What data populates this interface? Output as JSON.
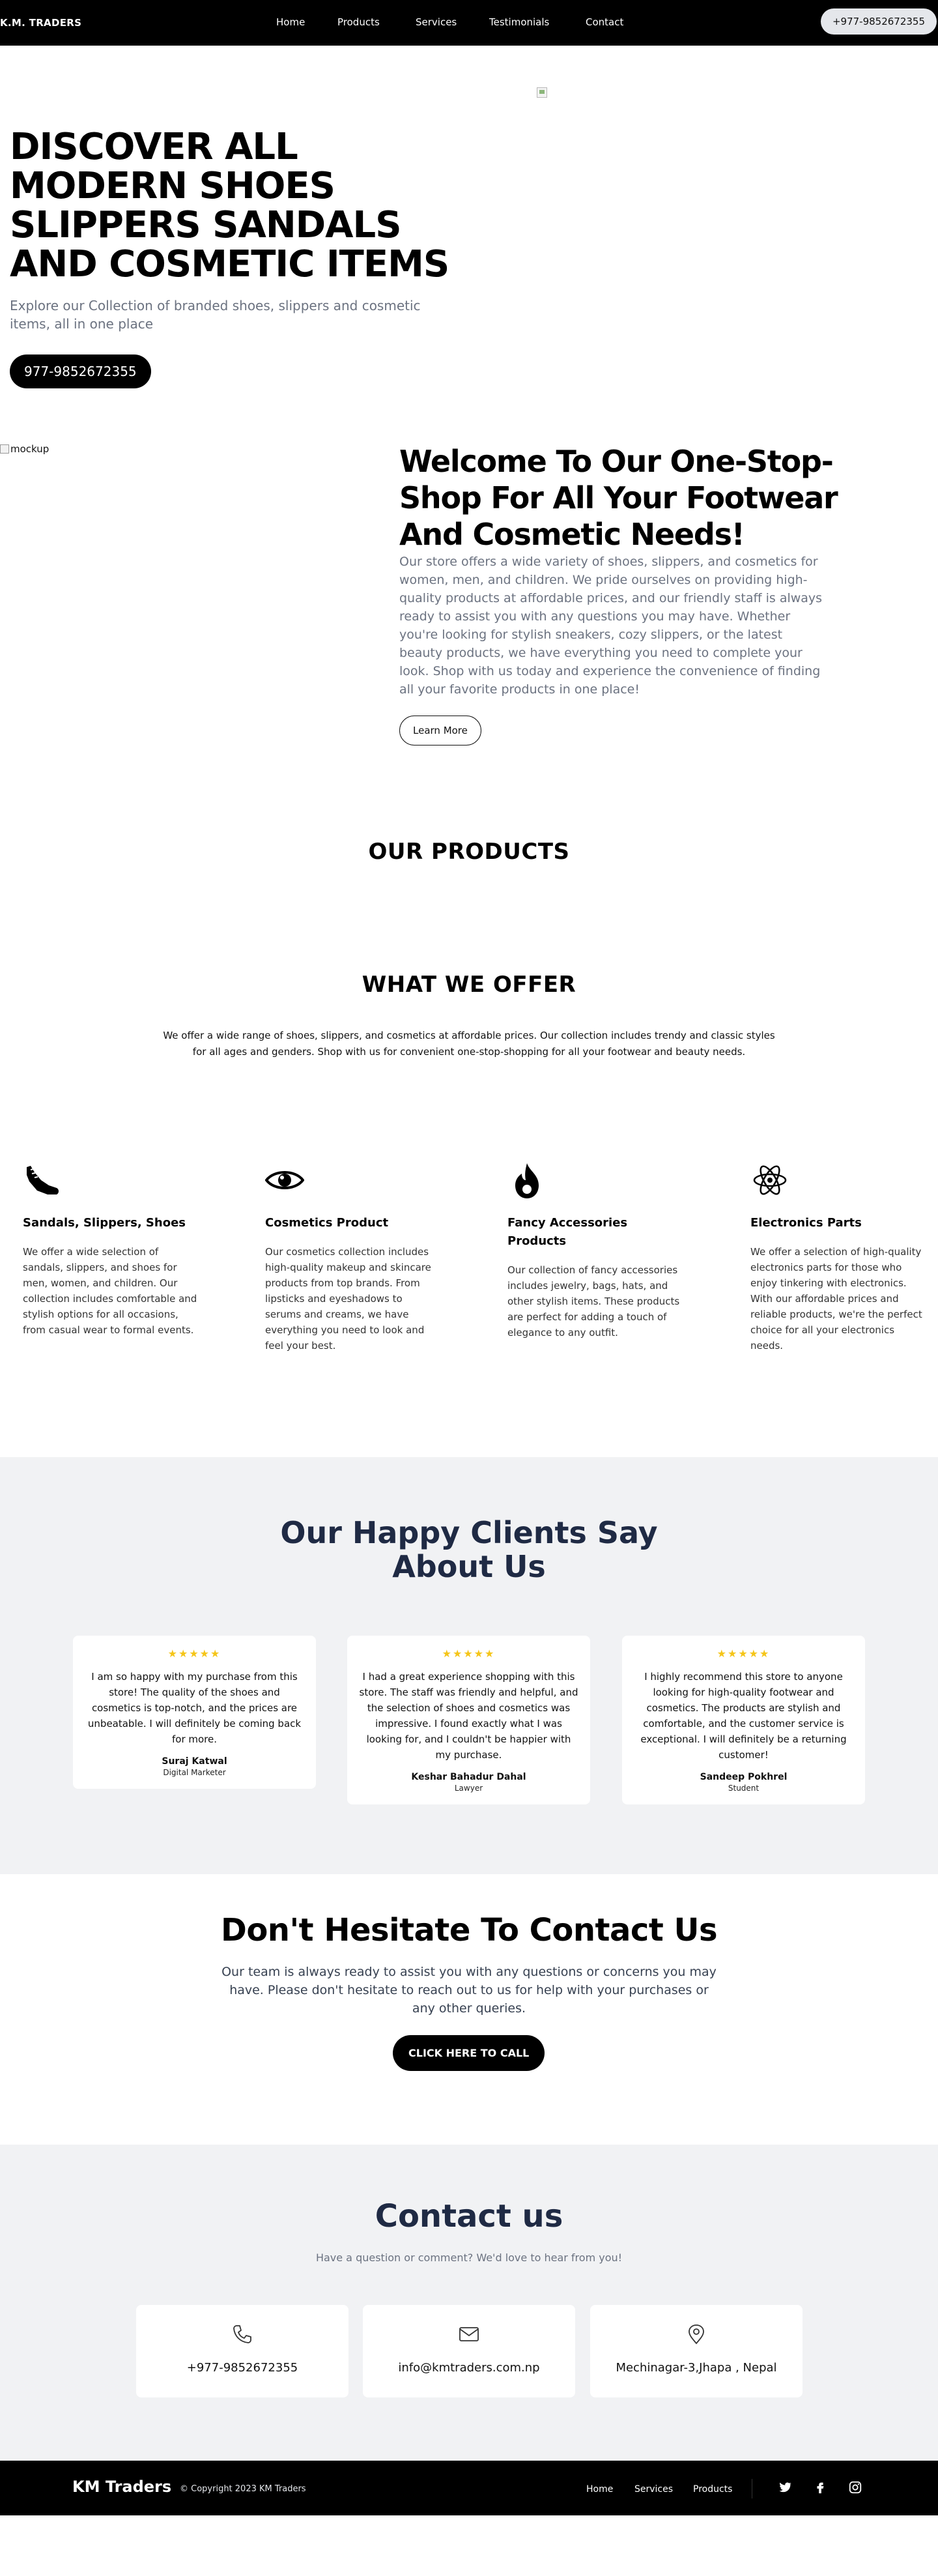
{
  "nav": {
    "brand": "K.M. TRADERS",
    "links": [
      "Home",
      "Products",
      "Services",
      "Testimonials",
      "Contact"
    ],
    "phone": "+977-9852672355"
  },
  "hero": {
    "title": "DISCOVER ALL MODERN SHOES SLIPPERS SANDALS AND COSMETIC ITEMS",
    "subtitle": "Explore our Collection of branded shoes, slippers and cosmetic items, all in one place",
    "phone_button": "977-9852672355"
  },
  "welcome": {
    "image_alt": "mockup",
    "title": "Welcome To Our One-Stop-Shop For All Your Footwear And Cosmetic Needs!",
    "text": "Our store offers a wide variety of shoes, slippers, and cosmetics for women, men, and children. We pride ourselves on providing high-quality products at affordable prices, and our friendly staff is always ready to assist you with any questions you may have. Whether you're looking for stylish sneakers, cozy slippers, or the latest beauty products, we have everything you need to complete your look. Shop with us today and experience the convenience of finding all your favorite products in one place!",
    "button": "Learn More"
  },
  "products": {
    "title": "OUR PRODUCTS"
  },
  "offer": {
    "title": "WHAT WE OFFER",
    "description": "We offer a wide range of shoes, slippers, and cosmetics at affordable prices. Our collection includes trendy and classic styles for all ages and genders. Shop with us for convenient one-stop-shopping for all your footwear and beauty needs.",
    "items": [
      {
        "icon": "shoe-icon",
        "title": "Sandals, Slippers, Shoes",
        "text": "We offer a wide selection of sandals, slippers, and shoes for men, women, and children. Our collection includes comfortable and stylish options for all occasions, from casual wear to formal events."
      },
      {
        "icon": "eye-icon",
        "title": "Cosmetics Product",
        "text": "Our cosmetics collection includes high-quality makeup and skincare products from top brands. From lipsticks and eyeshadows to serums and creams, we have everything you need to look and feel your best."
      },
      {
        "icon": "fire-icon",
        "title": "Fancy Accessories Products",
        "text": "Our collection of fancy accessories includes jewelry, bags, hats, and other stylish items. These products are perfect for adding a touch of elegance to any outfit."
      },
      {
        "icon": "atom-icon",
        "title": "Electronics Parts",
        "text": "We offer a selection of high-quality electronics parts for those who enjoy tinkering with electronics. With our affordable prices and reliable products, we're the perfect choice for all your electronics needs."
      }
    ]
  },
  "testimonials": {
    "title": "Our Happy Clients Say About Us",
    "items": [
      {
        "stars": "★★★★★",
        "quote": "I am so happy with my purchase from this store! The quality of the shoes and cosmetics is top-notch, and the prices are unbeatable. I will definitely be coming back for more.",
        "name": "Suraj Katwal",
        "role": "Digital Marketer"
      },
      {
        "stars": "★★★★★",
        "quote": "I had a great experience shopping with this store. The staff was friendly and helpful, and the selection of shoes and cosmetics was impressive. I found exactly what I was looking for, and I couldn't be happier with my purchase.",
        "name": "Keshar Bahadur Dahal",
        "role": "Lawyer"
      },
      {
        "stars": "★★★★★",
        "quote": "I highly recommend this store to anyone looking for high-quality footwear and cosmetics. The products are stylish and comfortable, and the customer service is exceptional. I will definitely be a returning customer!",
        "name": "Sandeep Pokhrel",
        "role": "Student"
      }
    ]
  },
  "cta": {
    "title": "Don't Hesitate To Contact Us",
    "text": "Our team is always ready to assist you with any questions or concerns you may have. Please don't hesitate to reach out to us for help with your purchases or any other queries.",
    "button": "CLICK HERE TO CALL"
  },
  "contact": {
    "title": "Contact us",
    "subtitle": "Have a question or comment? We'd love to hear from you!",
    "cards": [
      {
        "icon": "phone-icon",
        "value": "+977-9852672355"
      },
      {
        "icon": "mail-icon",
        "value": "info@kmtraders.com.np"
      },
      {
        "icon": "location-pin-icon",
        "value": "Mechinagar-3,Jhapa , Nepal"
      }
    ]
  },
  "footer": {
    "brand": "KM Traders",
    "copyright": "© Copyright 2023 KM Traders",
    "links": [
      "Home",
      "Services",
      "Products"
    ],
    "social": [
      "twitter-icon",
      "facebook-icon",
      "instagram-icon"
    ]
  }
}
